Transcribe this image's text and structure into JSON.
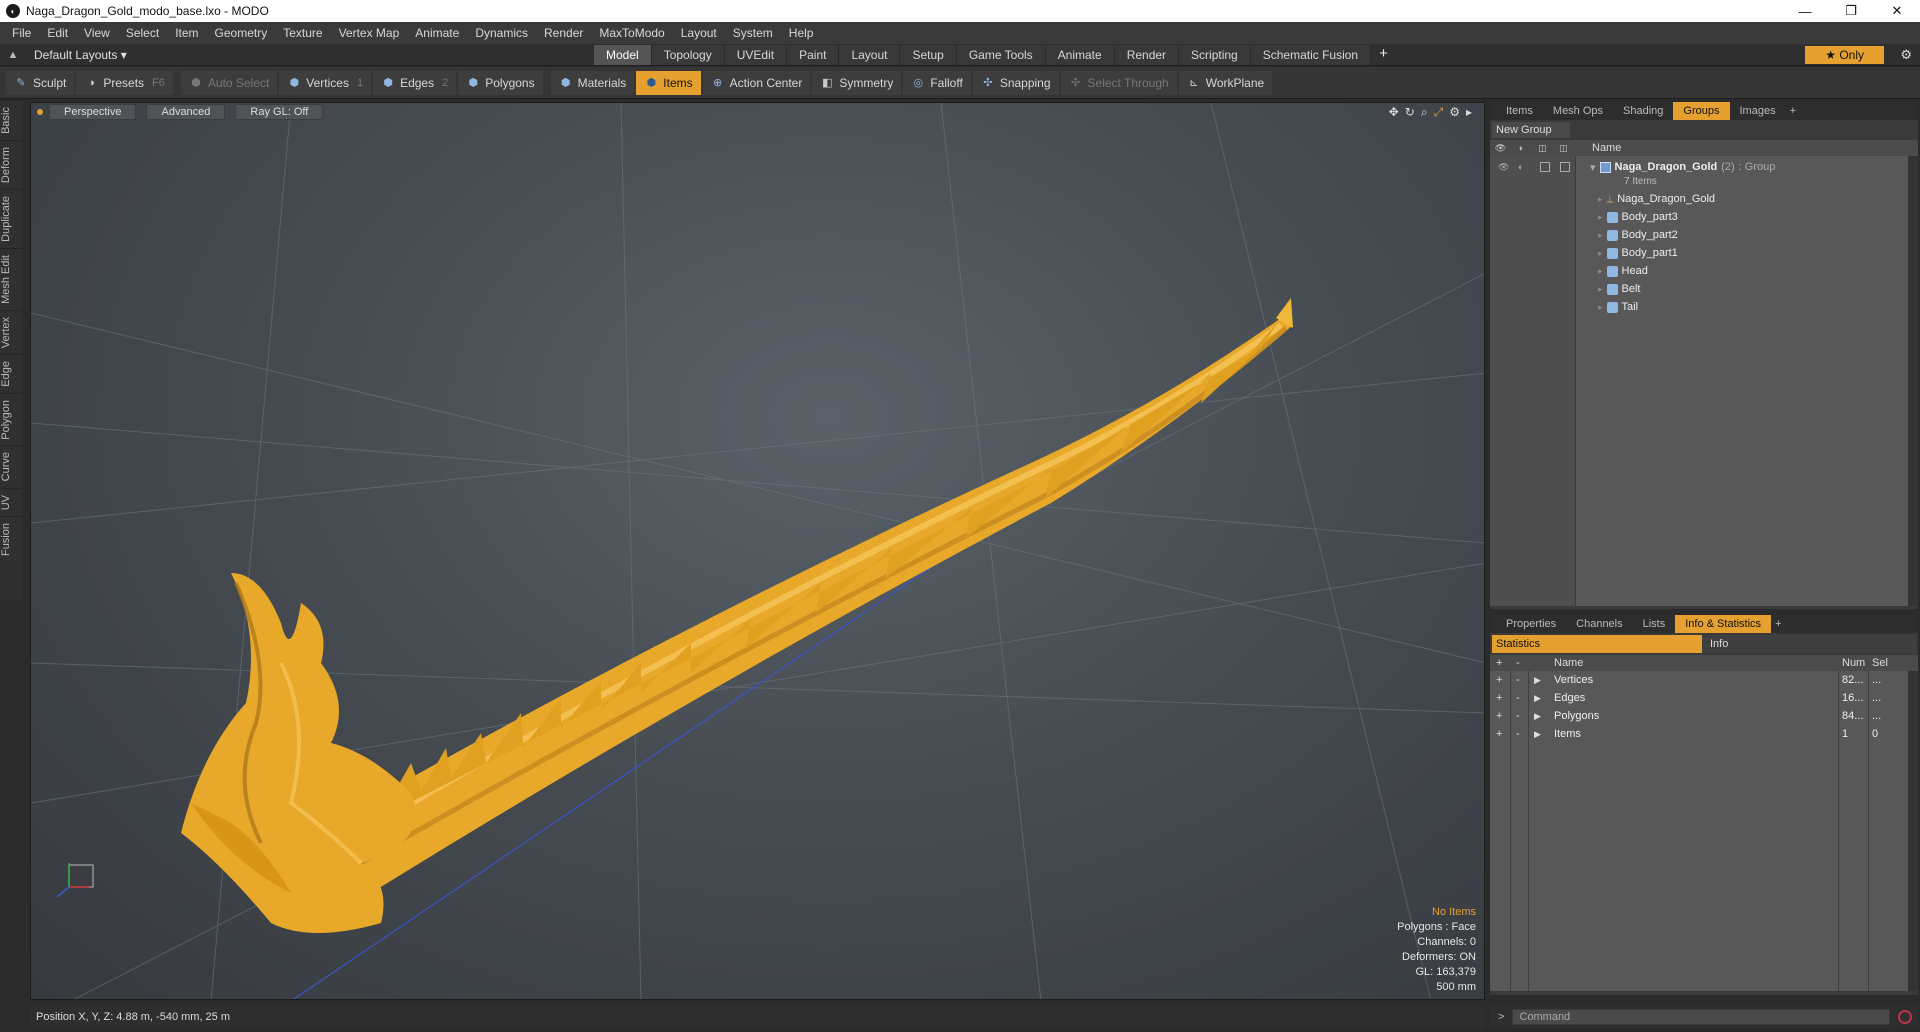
{
  "window": {
    "title": "Naga_Dragon_Gold_modo_base.lxo - MODO",
    "app_icon": "modo-logo-icon"
  },
  "menu": [
    "File",
    "Edit",
    "View",
    "Select",
    "Item",
    "Geometry",
    "Texture",
    "Vertex Map",
    "Animate",
    "Dynamics",
    "Render",
    "MaxToModo",
    "Layout",
    "System",
    "Help"
  ],
  "layoutbar": {
    "layout_select": "Default Layouts ▾",
    "tabs": [
      "Model",
      "Topology",
      "UVEdit",
      "Paint",
      "Layout",
      "Setup",
      "Game Tools",
      "Animate",
      "Render",
      "Scripting",
      "Schematic Fusion"
    ],
    "active_tab": "Model",
    "only_label": "★  Only"
  },
  "toolbar": {
    "sculpt": "Sculpt",
    "presets": "Presets",
    "presets_key": "F6",
    "auto_select": "Auto Select",
    "vertices": "Vertices",
    "vertices_key": "1",
    "edges": "Edges",
    "edges_key": "2",
    "polygons": "Polygons",
    "materials": "Materials",
    "items": "Items",
    "action_center": "Action Center",
    "symmetry": "Symmetry",
    "falloff": "Falloff",
    "snapping": "Snapping",
    "select_through": "Select Through",
    "workplane": "WorkPlane"
  },
  "left_tabs": [
    "Basic",
    "Deform",
    "Duplicate",
    "Mesh Edit",
    "Vertex",
    "Edge",
    "Polygon",
    "Curve",
    "UV",
    "Fusion"
  ],
  "viewport": {
    "view_mode": "Perspective",
    "shading": "Advanced",
    "raygl": "Ray GL: Off",
    "info": {
      "selection": "No Items",
      "polygons": "Polygons : Face",
      "channels": "Channels: 0",
      "deformers": "Deformers: ON",
      "gl": "GL: 163,379",
      "scale": "500 mm"
    },
    "model_color": "#f0b030"
  },
  "statusbar": {
    "position": "Position X, Y, Z:   4.88 m, -540 mm, 25 m"
  },
  "items_panel": {
    "tabs": [
      "Items",
      "Mesh Ops",
      "Shading",
      "Groups",
      "Images"
    ],
    "active_tab": "Groups",
    "new_group": "New Group",
    "name_header": "Name",
    "group": {
      "name": "Naga_Dragon_Gold",
      "count": "(2)",
      "type": ": Group",
      "items_count": "7 Items"
    },
    "children": [
      "Naga_Dragon_Gold",
      "Body_part3",
      "Body_part2",
      "Body_part1",
      "Head",
      "Belt",
      "Tail"
    ]
  },
  "stats_panel": {
    "tabs": [
      "Properties",
      "Channels",
      "Lists",
      "Info & Statistics"
    ],
    "active_tab": "Info & Statistics",
    "sub_tabs": [
      "Statistics",
      "Info"
    ],
    "headers": {
      "plus": "+",
      "minus": "-",
      "name": "Name",
      "num": "Num",
      "sel": "Sel"
    },
    "rows": [
      {
        "name": "Vertices",
        "num": "82...",
        "sel": "..."
      },
      {
        "name": "Edges",
        "num": "16...",
        "sel": "..."
      },
      {
        "name": "Polygons",
        "num": "84...",
        "sel": "..."
      },
      {
        "name": "Items",
        "num": "1",
        "sel": "0"
      }
    ]
  },
  "command": {
    "prompt": ">",
    "placeholder": "Command"
  }
}
